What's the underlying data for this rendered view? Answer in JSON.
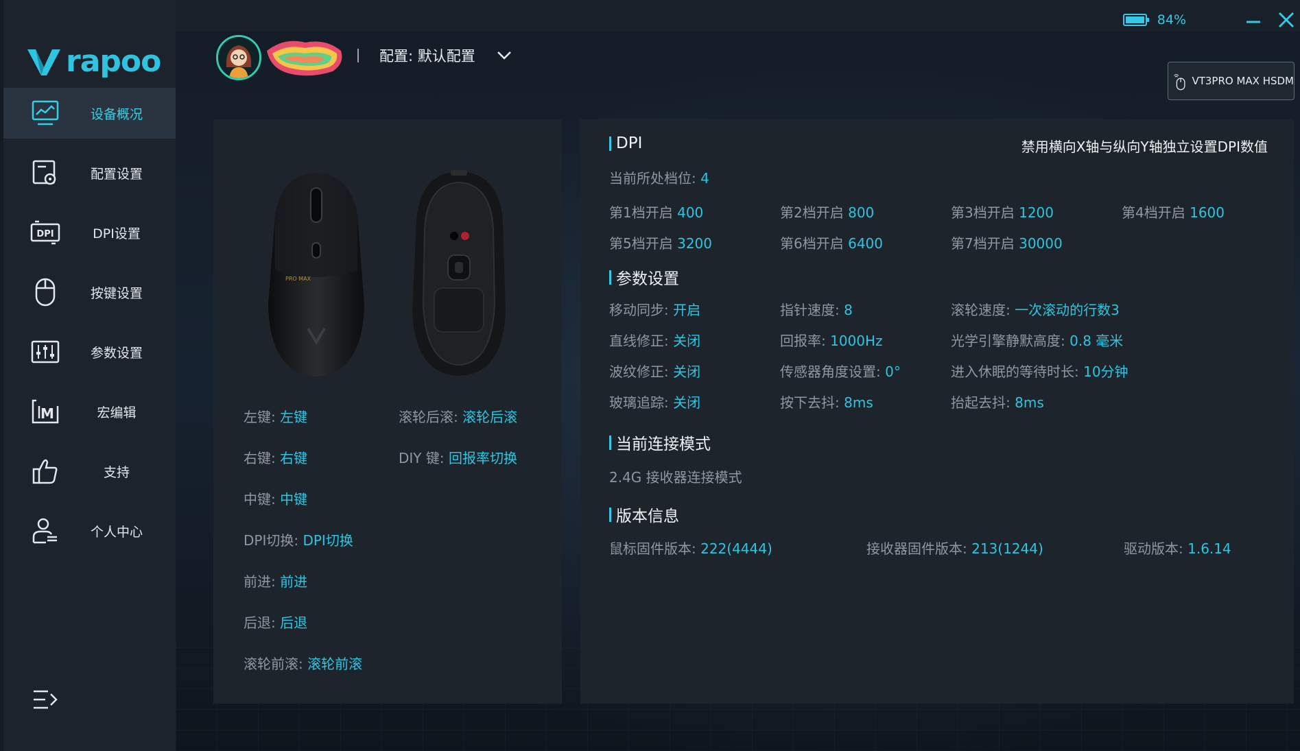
{
  "brand": {
    "logo_text": "rapoo",
    "accent": "#2fc5e0"
  },
  "sidebar": {
    "items": [
      {
        "label": "设备概况",
        "icon": "monitor-chart-icon",
        "active": true
      },
      {
        "label": "配置设置",
        "icon": "config-settings-icon",
        "active": false
      },
      {
        "label": "DPI设置",
        "icon": "dpi-icon",
        "active": false
      },
      {
        "label": "按键设置",
        "icon": "mouse-icon",
        "active": false
      },
      {
        "label": "参数设置",
        "icon": "sliders-icon",
        "active": false
      },
      {
        "label": "宏编辑",
        "icon": "macro-icon",
        "active": false
      },
      {
        "label": "支持",
        "icon": "thumbs-up-icon",
        "active": false
      },
      {
        "label": "个人中心",
        "icon": "user-icon",
        "active": false
      }
    ]
  },
  "topbar": {
    "battery": "84%"
  },
  "profile": {
    "label": "配置: 默认配置"
  },
  "device": {
    "name": "VT3PRO MAX HSDM"
  },
  "buttons": {
    "left": {
      "k": "左键:",
      "v": "左键"
    },
    "scroll_back": {
      "k": "滚轮后滚:",
      "v": "滚轮后滚"
    },
    "right": {
      "k": "右键:",
      "v": "右键"
    },
    "diy": {
      "k": "DIY 键:",
      "v": "回报率切换"
    },
    "middle": {
      "k": "中键:",
      "v": "中键"
    },
    "dpi_switch": {
      "k": "DPI切换:",
      "v": "DPI切换"
    },
    "forward": {
      "k": "前进:",
      "v": "前进"
    },
    "back": {
      "k": "后退:",
      "v": "后退"
    },
    "scroll_fwd": {
      "k": "滚轮前滚:",
      "v": "滚轮前滚"
    }
  },
  "dpi": {
    "title": "DPI",
    "toggle_text": "禁用横向X轴与纵向Y轴独立设置DPI数值",
    "current": {
      "k": "当前所处档位:",
      "v": "4"
    },
    "levels": [
      {
        "k": "第1档开启",
        "v": "400"
      },
      {
        "k": "第2档开启",
        "v": "800"
      },
      {
        "k": "第3档开启",
        "v": "1200"
      },
      {
        "k": "第4档开启",
        "v": "1600"
      },
      {
        "k": "第5档开启",
        "v": "3200"
      },
      {
        "k": "第6档开启",
        "v": "6400"
      },
      {
        "k": "第7档开启",
        "v": "30000"
      }
    ]
  },
  "params": {
    "title": "参数设置",
    "items": [
      {
        "k": "移动同步:",
        "v": "开启"
      },
      {
        "k": "指针速度:",
        "v": "8"
      },
      {
        "k": "滚轮速度:",
        "v": "一次滚动的行数3"
      },
      {
        "k": "直线修正:",
        "v": "关闭"
      },
      {
        "k": "回报率:",
        "v": "1000Hz"
      },
      {
        "k": "光学引擎静默高度:",
        "v": "0.8 毫米"
      },
      {
        "k": "波纹修正:",
        "v": "关闭"
      },
      {
        "k": "传感器角度设置:",
        "v": "0°"
      },
      {
        "k": "进入休眠的等待时长:",
        "v": "10分钟"
      },
      {
        "k": "玻璃追踪:",
        "v": "关闭"
      },
      {
        "k": "按下去抖:",
        "v": "8ms"
      },
      {
        "k": "抬起去抖:",
        "v": "8ms"
      }
    ]
  },
  "connection": {
    "title": "当前连接模式",
    "mode": "2.4G 接收器连接模式"
  },
  "version": {
    "title": "版本信息",
    "mouse_fw": {
      "k": "鼠标固件版本:",
      "v": "222(4444)"
    },
    "receiver_fw": {
      "k": "接收器固件版本:",
      "v": "213(1244)"
    },
    "driver": {
      "k": "驱动版本:",
      "v": "1.6.14"
    }
  },
  "mouse_image": {
    "model_text": "PRO MAX"
  }
}
